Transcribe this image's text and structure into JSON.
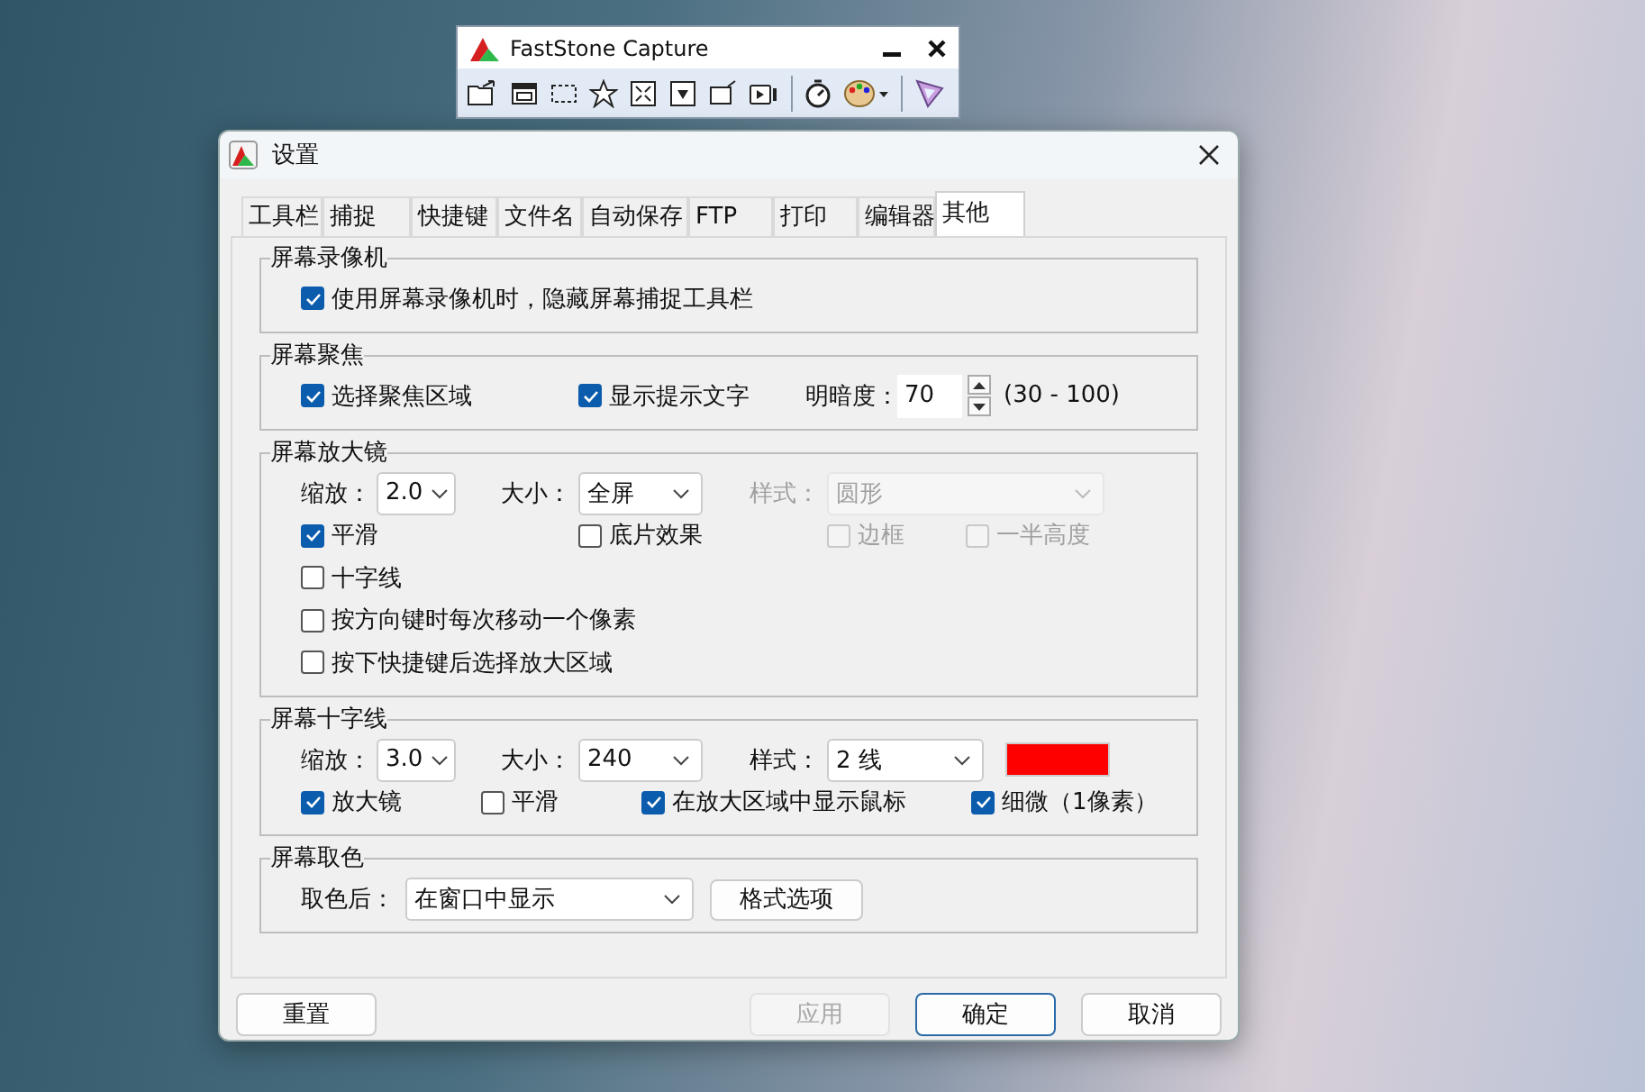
{
  "capture_toolbar": {
    "title": "FastStone Capture"
  },
  "settings_dialog": {
    "title": "设置",
    "tabs": [
      {
        "label": "工具栏",
        "selected": false
      },
      {
        "label": "捕捉",
        "selected": false
      },
      {
        "label": "快捷键",
        "selected": false
      },
      {
        "label": "文件名",
        "selected": false
      },
      {
        "label": "自动保存",
        "selected": false
      },
      {
        "label": "FTP",
        "selected": false
      },
      {
        "label": "打印",
        "selected": false
      },
      {
        "label": "编辑器",
        "selected": false
      },
      {
        "label": "其他",
        "selected": true
      }
    ],
    "groups": [
      {
        "title": "屏幕录像机",
        "rows": [
          [
            {
              "kind": "checkbox",
              "label": "使用屏幕录像机时，隐藏屏幕捕捉工具栏",
              "checked": true,
              "disabled": false
            }
          ]
        ]
      },
      {
        "title": "屏幕聚焦",
        "rows": [
          [
            {
              "kind": "checkbox",
              "label": "选择聚焦区域",
              "checked": true,
              "disabled": false
            },
            {
              "kind": "checkbox",
              "label": "显示提示文字",
              "checked": true,
              "disabled": false
            },
            {
              "kind": "spinner",
              "label": "明暗度：",
              "value": "70"
            },
            {
              "kind": "text",
              "text": "(30 - 100)"
            }
          ]
        ]
      },
      {
        "title": "屏幕放大镜",
        "rows": [
          [
            {
              "kind": "select",
              "label": "缩放：",
              "value": "2.0",
              "disabled": false
            },
            {
              "kind": "select",
              "label": "大小：",
              "value": "全屏",
              "disabled": false
            },
            {
              "kind": "select",
              "label": "样式：",
              "value": "圆形",
              "disabled": true
            }
          ],
          [
            {
              "kind": "checkbox",
              "label": "平滑",
              "checked": true,
              "disabled": false
            },
            {
              "kind": "checkbox",
              "label": "底片效果",
              "checked": false,
              "disabled": false
            },
            {
              "kind": "checkbox",
              "label": "边框",
              "checked": false,
              "disabled": true
            },
            {
              "kind": "checkbox",
              "label": "一半高度",
              "checked": false,
              "disabled": true
            }
          ],
          [
            {
              "kind": "checkbox",
              "label": "十字线",
              "checked": false,
              "disabled": false
            }
          ],
          [
            {
              "kind": "checkbox",
              "label": "按方向键时每次移动一个像素",
              "checked": false,
              "disabled": false
            }
          ],
          [
            {
              "kind": "checkbox",
              "label": "按下快捷键后选择放大区域",
              "checked": false,
              "disabled": false
            }
          ]
        ]
      },
      {
        "title": "屏幕十字线",
        "rows": [
          [
            {
              "kind": "select",
              "label": "缩放：",
              "value": "3.0",
              "disabled": false
            },
            {
              "kind": "select",
              "label": "大小：",
              "value": "240",
              "disabled": false
            },
            {
              "kind": "select",
              "label": "样式：",
              "value": "2 线",
              "disabled": false
            },
            {
              "kind": "color",
              "color": "#ff0000"
            }
          ],
          [
            {
              "kind": "checkbox",
              "label": "放大镜",
              "checked": true,
              "disabled": false
            },
            {
              "kind": "checkbox",
              "label": "平滑",
              "checked": false,
              "disabled": false
            },
            {
              "kind": "checkbox",
              "label": "在放大区域中显示鼠标",
              "checked": true,
              "disabled": false
            },
            {
              "kind": "checkbox",
              "label": "细微（1像素）",
              "checked": true,
              "disabled": false
            }
          ]
        ]
      },
      {
        "title": "屏幕取色",
        "rows": [
          [
            {
              "kind": "select",
              "label": "取色后：",
              "value": "在窗口中显示",
              "disabled": false
            },
            {
              "kind": "button",
              "label": "格式选项"
            }
          ]
        ]
      }
    ],
    "buttons": [
      {
        "label": "重置",
        "disabled": false,
        "default": false
      },
      {
        "label": "应用",
        "disabled": true,
        "default": false
      },
      {
        "label": "确定",
        "disabled": false,
        "default": true
      },
      {
        "label": "取消",
        "disabled": false,
        "default": false
      }
    ]
  }
}
